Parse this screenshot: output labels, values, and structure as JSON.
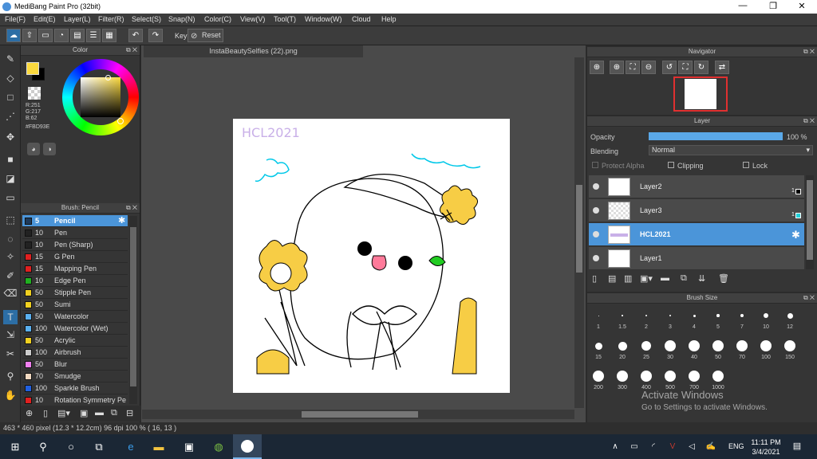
{
  "window": {
    "title": "MediBang Paint Pro (32bit)",
    "min": "—",
    "max": "❐",
    "close": "✕"
  },
  "menu": [
    "File(F)",
    "Edit(E)",
    "Layer(L)",
    "Filter(R)",
    "Select(S)",
    "Snap(N)",
    "Color(C)",
    "View(V)",
    "Tool(T)",
    "Window(W)",
    "Cloud",
    "Help"
  ],
  "toolbar": {
    "key_label": "Key",
    "reset_label": "Reset"
  },
  "color_panel": {
    "title": "Color",
    "r": "R:251",
    "g": "G:217",
    "b": "B:62",
    "hex": "#FBD93E",
    "fg_color": "#FBD93E",
    "bg_color": "#000000"
  },
  "brush_panel": {
    "title": "Brush: Pencil",
    "items": [
      {
        "size": "5",
        "name": "Pencil",
        "color": "#1e3a5a",
        "selected": true
      },
      {
        "size": "10",
        "name": "Pen",
        "color": "#222222"
      },
      {
        "size": "10",
        "name": "Pen (Sharp)",
        "color": "#222222"
      },
      {
        "size": "15",
        "name": "G Pen",
        "color": "#e02020"
      },
      {
        "size": "15",
        "name": "Mapping Pen",
        "color": "#e02020"
      },
      {
        "size": "10",
        "name": "Edge Pen",
        "color": "#20b020"
      },
      {
        "size": "50",
        "name": "Stipple Pen",
        "color": "#f0d020"
      },
      {
        "size": "50",
        "name": "Sumi",
        "color": "#f0d020"
      },
      {
        "size": "50",
        "name": "Watercolor",
        "color": "#5ab0f0"
      },
      {
        "size": "100",
        "name": "Watercolor (Wet)",
        "color": "#5ab0f0"
      },
      {
        "size": "50",
        "name": "Acrylic",
        "color": "#f0d020"
      },
      {
        "size": "100",
        "name": "Airbrush",
        "color": "#cccccc"
      },
      {
        "size": "50",
        "name": "Blur",
        "color": "#f080f0"
      },
      {
        "size": "70",
        "name": "Smudge",
        "color": "#f0d8c0"
      },
      {
        "size": "100",
        "name": "Sparkle Brush",
        "color": "#2060e0"
      },
      {
        "size": "10",
        "name": "Rotation Symmetry Pe",
        "color": "#e02020"
      }
    ]
  },
  "document": {
    "tab": "InstaBeautySelfies (22).png",
    "canvas_text": "HCL2021"
  },
  "navigator": {
    "title": "Navigator"
  },
  "layer_panel": {
    "title": "Layer",
    "opacity_label": "Opacity",
    "opacity_value": "100 %",
    "opacity": 1.0,
    "blending_label": "Blending",
    "blending_value": "Normal",
    "protect_alpha": "Protect Alpha",
    "clipping": "Clipping",
    "lock": "Lock",
    "layers": [
      {
        "name": "Layer2",
        "selected": false
      },
      {
        "name": "Layer3",
        "selected": false
      },
      {
        "name": "HCL2021",
        "selected": true
      },
      {
        "name": "Layer1",
        "selected": false
      }
    ],
    "layer_indicators": [
      "1",
      "1"
    ]
  },
  "brush_size": {
    "title": "Brush Size",
    "sizes": [
      "1",
      "1.5",
      "2",
      "3",
      "4",
      "5",
      "7",
      "10",
      "12",
      "15",
      "20",
      "25",
      "30",
      "40",
      "50",
      "70",
      "100",
      "150",
      "200",
      "300",
      "400",
      "500",
      "700",
      "1000"
    ]
  },
  "status": "463 * 460 pixel   (12.3 * 12.2cm)   96 dpi   100 %   ( 16, 13 )",
  "watermark": {
    "line1": "Activate Windows",
    "line2": "Go to Settings to activate Windows."
  },
  "taskbar": {
    "lang": "ENG",
    "time": "11:11 PM",
    "date": "3/4/2021"
  }
}
